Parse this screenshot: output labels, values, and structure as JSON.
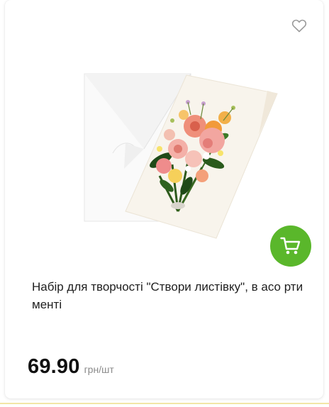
{
  "product": {
    "title": "Набір для творчості \"Створи листівку\", в асо ртименті",
    "price": "69.90",
    "unit": "грн/шт",
    "image_alt": "greeting card with beaded flower bouquet and white envelope"
  },
  "actions": {
    "favorite_icon": "heart-outline-icon",
    "cart_icon": "shopping-cart-icon"
  },
  "colors": {
    "cart_button": "#5ab72b",
    "favorite_icon": "#9b9b9b",
    "bottom_line": "#f2e6a6"
  }
}
